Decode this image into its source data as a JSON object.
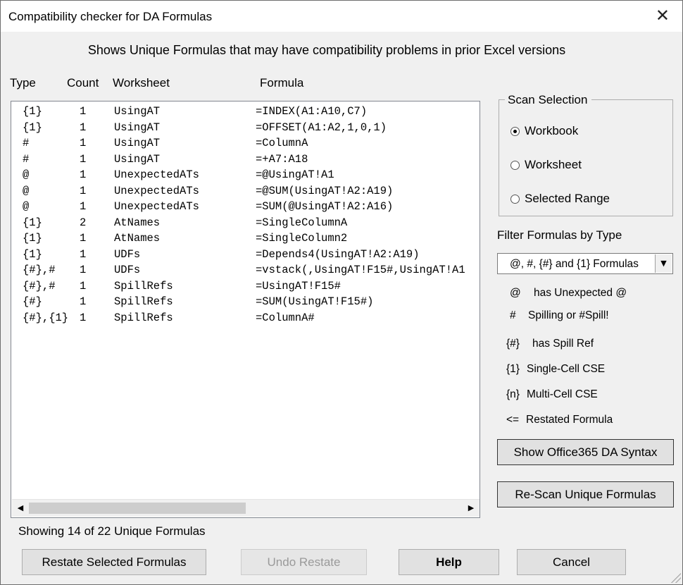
{
  "window": {
    "title": "Compatibility checker for DA Formulas",
    "close_glyph": "✕"
  },
  "headline": "Shows Unique Formulas that may have compatibility problems in prior Excel versions",
  "columns": {
    "type": "Type",
    "count": "Count",
    "worksheet": "Worksheet",
    "formula": "Formula"
  },
  "rows": [
    {
      "type": "{1}",
      "count": "1",
      "worksheet": "UsingAT",
      "formula": "=INDEX(A1:A10,C7)"
    },
    {
      "type": "{1}",
      "count": "1",
      "worksheet": "UsingAT",
      "formula": "=OFFSET(A1:A2,1,0,1)"
    },
    {
      "type": "#",
      "count": "1",
      "worksheet": "UsingAT",
      "formula": "=ColumnA"
    },
    {
      "type": "#",
      "count": "1",
      "worksheet": "UsingAT",
      "formula": "=+A7:A18"
    },
    {
      "type": "@",
      "count": "1",
      "worksheet": "UnexpectedATs",
      "formula": "=@UsingAT!A1"
    },
    {
      "type": "@",
      "count": "1",
      "worksheet": "UnexpectedATs",
      "formula": "=@SUM(UsingAT!A2:A19)"
    },
    {
      "type": "@",
      "count": "1",
      "worksheet": "UnexpectedATs",
      "formula": "=SUM(@UsingAT!A2:A16)"
    },
    {
      "type": "{1}",
      "count": "2",
      "worksheet": "AtNames",
      "formula": "=SingleColumnA"
    },
    {
      "type": "{1}",
      "count": "1",
      "worksheet": "AtNames",
      "formula": "=SingleColumn2"
    },
    {
      "type": "{1}",
      "count": "1",
      "worksheet": "UDFs",
      "formula": "=Depends4(UsingAT!A2:A19)"
    },
    {
      "type": "{#},#",
      "count": "1",
      "worksheet": "UDFs",
      "formula": "=vstack(,UsingAT!F15#,UsingAT!A1"
    },
    {
      "type": "{#},#",
      "count": "1",
      "worksheet": "SpillRefs",
      "formula": "=UsingAT!F15#"
    },
    {
      "type": "{#}",
      "count": "1",
      "worksheet": "SpillRefs",
      "formula": "=SUM(UsingAT!F15#)"
    },
    {
      "type": "{#},{1}",
      "count": "1",
      "worksheet": "SpillRefs",
      "formula": "=ColumnA#"
    }
  ],
  "scrollbar": {
    "left_glyph": "◀",
    "right_glyph": "▶"
  },
  "status": "Showing 14 of 22 Unique Formulas",
  "scan": {
    "legend": "Scan Selection",
    "options": [
      "Workbook",
      "Worksheet",
      "Selected Range"
    ],
    "selected": "Workbook"
  },
  "filter": {
    "label": "Filter Formulas by Type",
    "value": "@, #, {#} and {1} Formulas",
    "arrow_glyph": "▼"
  },
  "key": [
    {
      "symbol": "@",
      "text": "has Unexpected @"
    },
    {
      "symbol": "#",
      "text": "Spilling or #Spill!"
    },
    {
      "symbol": "{#}",
      "text": "has Spill Ref"
    },
    {
      "symbol": "{1}",
      "text": "Single-Cell CSE"
    },
    {
      "symbol": "{n}",
      "text": "Multi-Cell CSE"
    },
    {
      "symbol": "<=",
      "text": "Restated Formula"
    }
  ],
  "buttons": {
    "show_syntax": "Show Office365 DA Syntax",
    "rescan": "Re-Scan Unique Formulas",
    "restate": "Restate Selected Formulas",
    "undo": "Undo Restate",
    "help": "Help",
    "cancel": "Cancel"
  }
}
